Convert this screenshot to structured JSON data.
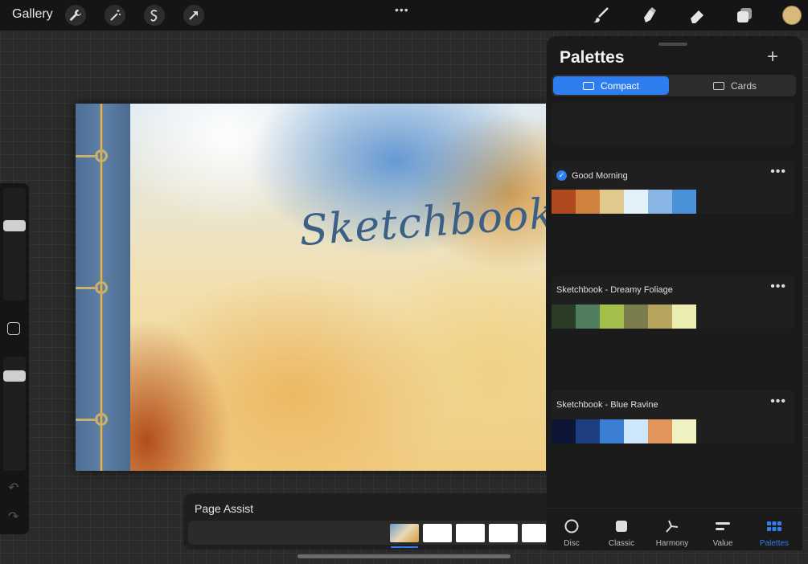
{
  "toolbar": {
    "gallery_label": "Gallery",
    "left_tools": [
      "wrench-icon",
      "magic-wand-icon",
      "selection-icon",
      "transform-arrow-icon"
    ],
    "center_menu": "•••",
    "right_tools": [
      "brush-icon",
      "smudge-icon",
      "eraser-icon",
      "layers-icon"
    ],
    "current_color": "#d9b97a"
  },
  "canvas": {
    "title_text": "Sketchbook"
  },
  "page_assist": {
    "title": "Page Assist",
    "pages": 5,
    "selected_page": 1
  },
  "palettes_panel": {
    "title": "Palettes",
    "add_label": "+",
    "view_modes": [
      {
        "label": "Compact",
        "selected": true
      },
      {
        "label": "Cards",
        "selected": false
      }
    ],
    "palettes": [
      {
        "name": "Good Morning",
        "default": true,
        "more": "•••",
        "colors": [
          "#b04a1e",
          "#d28240",
          "#e1c88d",
          "#e3f1fb",
          "#8ab6e6",
          "#4a92d8"
        ]
      },
      {
        "name": "Sketchbook - Dreamy Foliage",
        "default": false,
        "more": "•••",
        "colors": [
          "#2a3d24",
          "#4f7d5e",
          "#a4bf4a",
          "#7b7d4c",
          "#b7a45c",
          "#ebedb0"
        ]
      },
      {
        "name": "Sketchbook - Blue Ravine",
        "default": false,
        "more": "•••",
        "colors": [
          "#0d1637",
          "#1d3f80",
          "#3b7fd5",
          "#cfe7fb",
          "#e2955a",
          "#eff1c0"
        ]
      }
    ]
  },
  "color_tabs": [
    {
      "label": "Disc",
      "icon": "disc-icon",
      "active": false
    },
    {
      "label": "Classic",
      "icon": "classic-square-icon",
      "active": false
    },
    {
      "label": "Harmony",
      "icon": "harmony-icon",
      "active": false
    },
    {
      "label": "Value",
      "icon": "value-sliders-icon",
      "active": false
    },
    {
      "label": "Palettes",
      "icon": "palettes-grid-icon",
      "active": true
    }
  ]
}
